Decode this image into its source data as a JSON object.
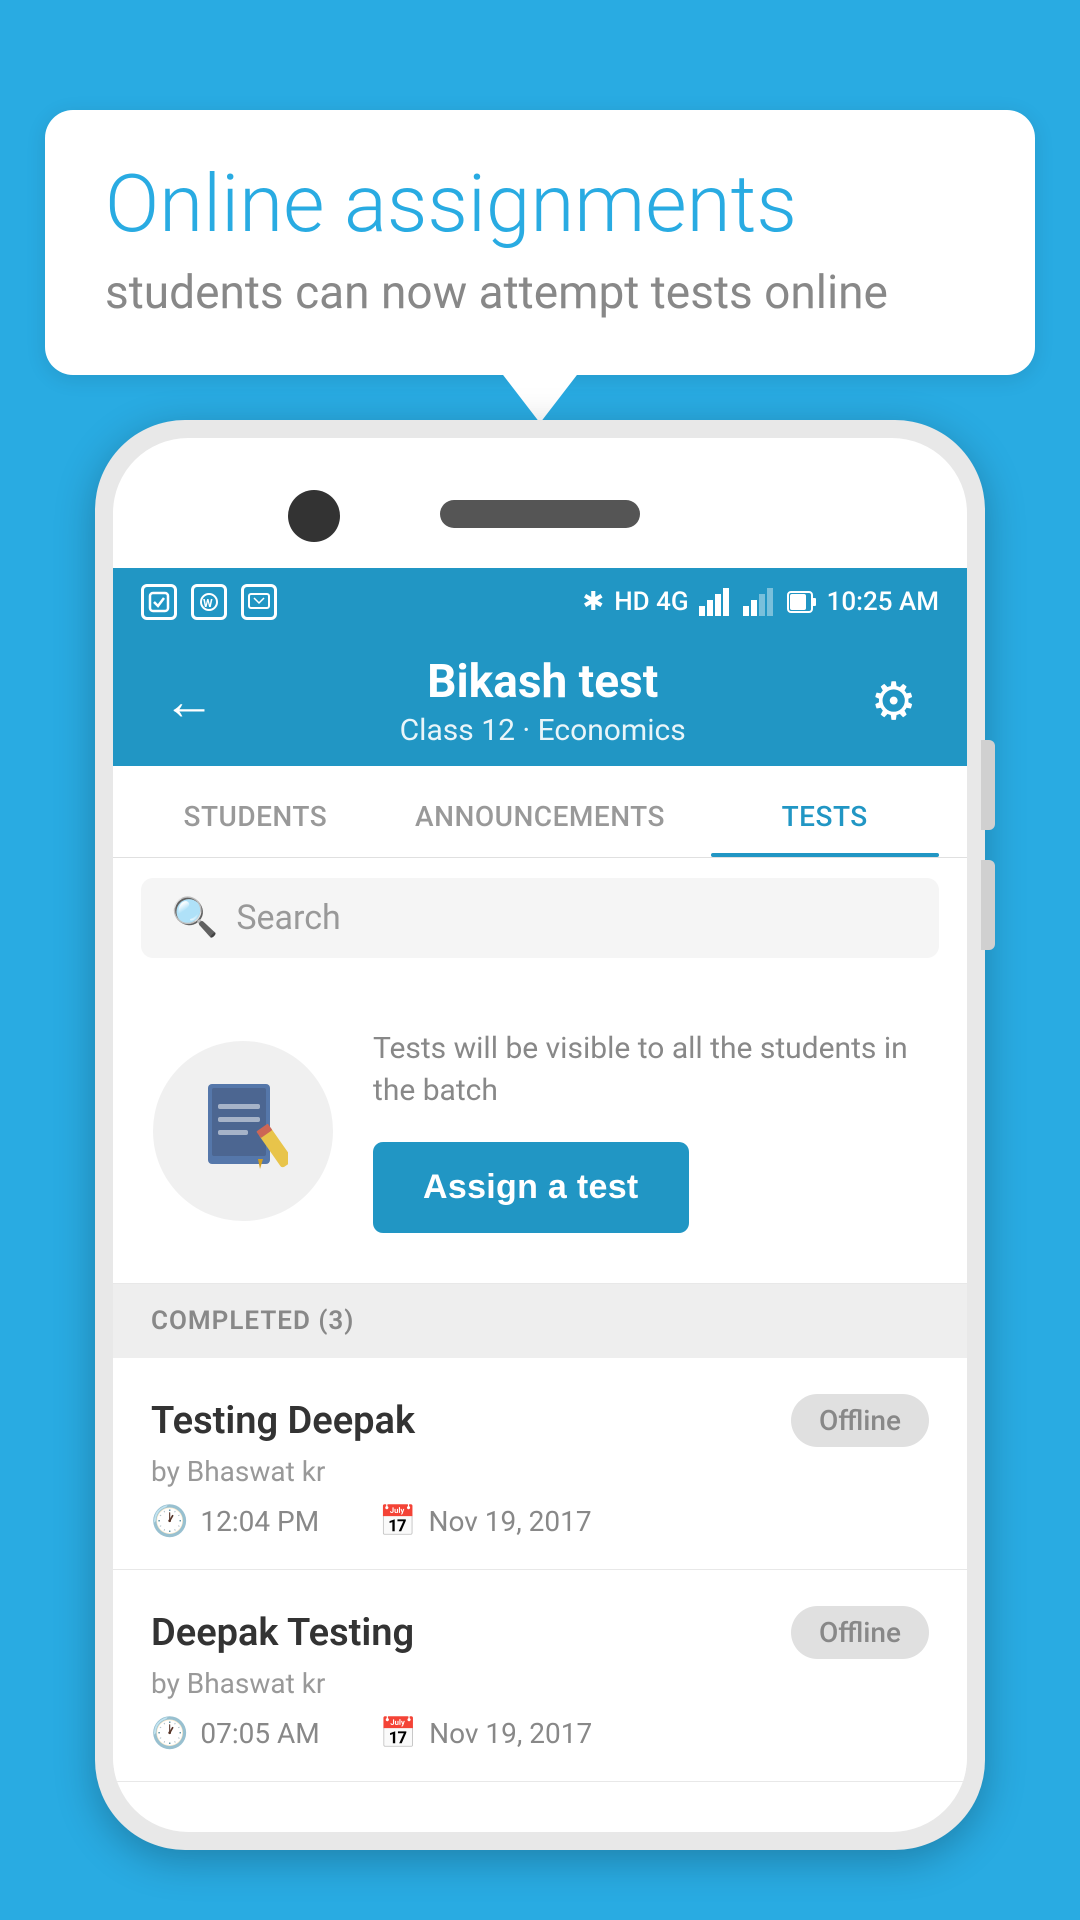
{
  "background_color": "#29abe2",
  "speech_bubble": {
    "title": "Online assignments",
    "subtitle": "students can now attempt tests online"
  },
  "status_bar": {
    "time": "10:25 AM",
    "network": "HD 4G"
  },
  "app_bar": {
    "title": "Bikash test",
    "subtitle": "Class 12 · Economics",
    "back_label": "←",
    "settings_label": "⚙"
  },
  "tabs": [
    {
      "label": "STUDENTS",
      "active": false
    },
    {
      "label": "ANNOUNCEMENTS",
      "active": false
    },
    {
      "label": "TESTS",
      "active": true
    }
  ],
  "search": {
    "placeholder": "Search"
  },
  "assign_section": {
    "description": "Tests will be visible to all the students in the batch",
    "button_label": "Assign a test"
  },
  "completed_section": {
    "header": "COMPLETED (3)",
    "items": [
      {
        "name": "Testing Deepak",
        "by": "by Bhaswat kr",
        "time": "12:04 PM",
        "date": "Nov 19, 2017",
        "status": "Offline"
      },
      {
        "name": "Deepak Testing",
        "by": "by Bhaswat kr",
        "time": "07:05 AM",
        "date": "Nov 19, 2017",
        "status": "Offline"
      }
    ]
  }
}
